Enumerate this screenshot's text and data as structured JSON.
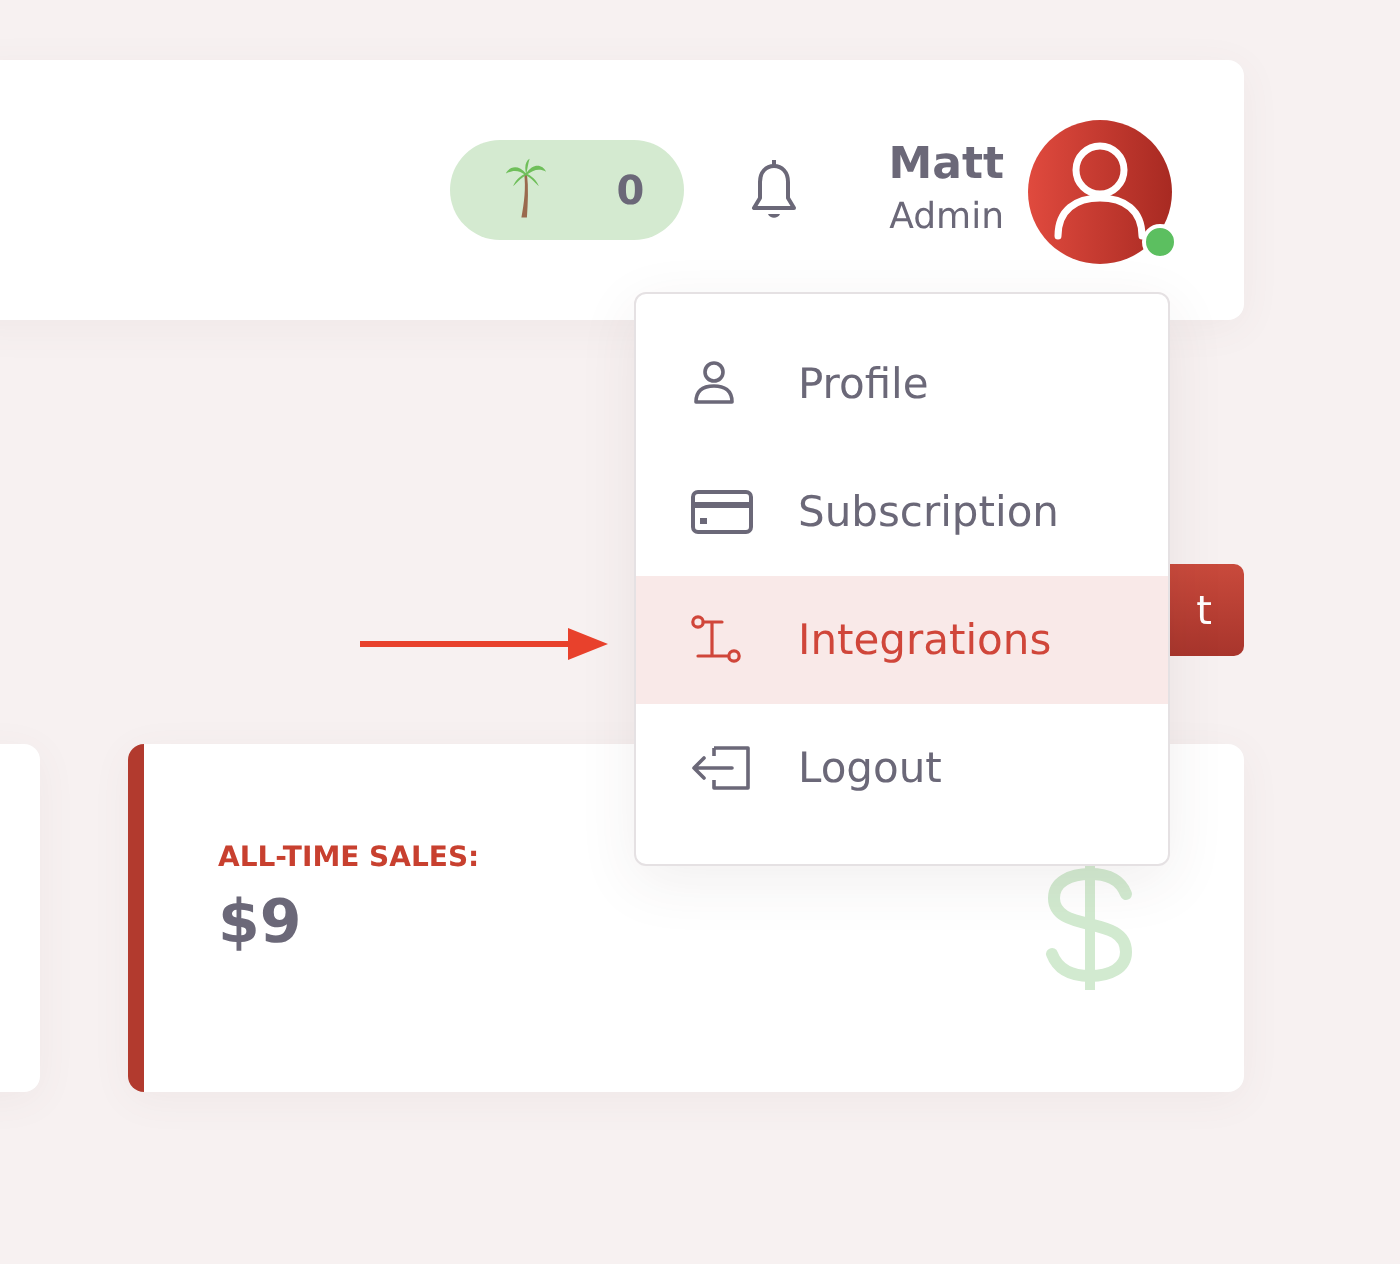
{
  "header": {
    "points_badge": {
      "count": "0"
    },
    "user": {
      "name": "Matt",
      "role": "Admin",
      "online": true
    }
  },
  "user_menu": {
    "items": [
      {
        "label": "Profile",
        "kind": "person",
        "selected": false
      },
      {
        "label": "Subscription",
        "kind": "card",
        "selected": false
      },
      {
        "label": "Integrations",
        "kind": "nodes",
        "selected": true
      },
      {
        "label": "Logout",
        "kind": "logout",
        "selected": false
      }
    ]
  },
  "action_button": {
    "label": "t"
  },
  "stat_card": {
    "label": "ALL-TIME SALES:",
    "value": "$9"
  }
}
